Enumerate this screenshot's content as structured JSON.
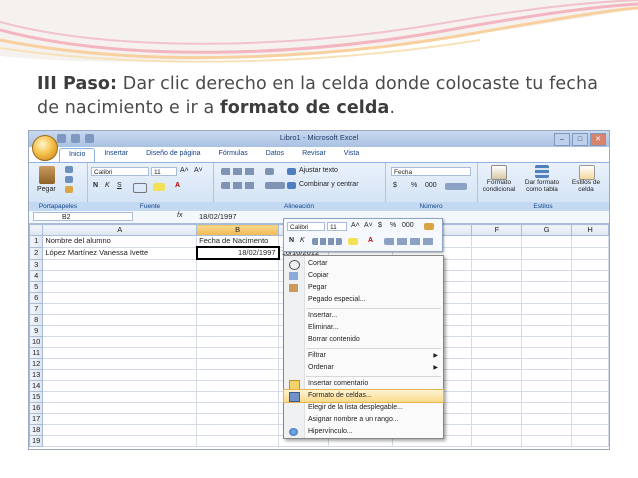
{
  "slide": {
    "step_label": "III Paso:",
    "text_1": " Dar clic derecho en la celda donde colocaste tu fecha de nacimiento e ir a ",
    "bold_phrase": "formato de celda",
    "text_2": "."
  },
  "excel": {
    "window_title": "Libro1 - Microsoft Excel",
    "window_buttons": [
      "–",
      "□",
      "✕"
    ],
    "tabs": [
      "Inicio",
      "Insertar",
      "Diseño de página",
      "Fórmulas",
      "Datos",
      "Revisar",
      "Vista"
    ],
    "active_tab": "Inicio",
    "ribbon": {
      "paste_label": "Pegar",
      "clipboard_group": "Portapapeles",
      "font_name": "Calibri",
      "font_size": "11",
      "grow_font": "A˄",
      "shrink_font": "A˅",
      "bold": "N",
      "italic": "K",
      "underline": "S",
      "font_color": "A",
      "font_group": "Fuente",
      "wrap_text": "Ajustar texto",
      "merge_center": "Combinar y centrar",
      "alignment_group": "Alineación",
      "number_format": "Fecha",
      "currency": "$",
      "percent": "%",
      "thousands": "000",
      "number_group": "Número",
      "conditional_format": "Formato condicional",
      "format_table": "Dar formato como tabla",
      "cell_styles": "Estilos de celda",
      "styles_group": "Estilos"
    },
    "name_box": "B2",
    "fx": "fx",
    "formula_value": "18/02/1997",
    "columns": [
      "A",
      "B",
      "C",
      "D",
      "E",
      "F",
      "G",
      "H"
    ],
    "rows": [
      "1",
      "2",
      "3",
      "4",
      "5",
      "6",
      "7",
      "8",
      "9",
      "10",
      "11",
      "12",
      "13",
      "14",
      "15",
      "16",
      "17",
      "18",
      "19"
    ],
    "cells": {
      "a1": "Nombre del alumno",
      "b1": "Fecha de Nacimento",
      "a2": "López Martínez Vanessa Ivette",
      "b2": "18/02/1997",
      "c2": "10/10/2012"
    },
    "mini_toolbar": {
      "font": "Calibri",
      "size": "11",
      "grow": "A˄",
      "shrink": "A˅",
      "currency": "$",
      "percent": "%",
      "thousands": "000",
      "bold": "N",
      "italic": "K",
      "font_color": "A"
    },
    "context_menu": [
      {
        "label": "Cortar",
        "icon": "scissors-icon"
      },
      {
        "label": "Copiar",
        "icon": "copy-icon"
      },
      {
        "label": "Pegar",
        "icon": "paste-icon"
      },
      {
        "label": "Pegado especial...",
        "icon": ""
      },
      {
        "label": "Insertar...",
        "icon": ""
      },
      {
        "label": "Eliminar...",
        "icon": ""
      },
      {
        "label": "Borrar contenido",
        "icon": ""
      },
      {
        "label": "Filtrar",
        "icon": "",
        "submenu": true
      },
      {
        "label": "Ordenar",
        "icon": "",
        "submenu": true
      },
      {
        "label": "Insertar comentario",
        "icon": "comment-icon"
      },
      {
        "label": "Formato de celdas...",
        "icon": "format-cells-icon",
        "highlighted": true
      },
      {
        "label": "Elegir de la lista desplegable...",
        "icon": ""
      },
      {
        "label": "Asignar nombre a un rango...",
        "icon": ""
      },
      {
        "label": "Hipervínculo...",
        "icon": "hyperlink-icon"
      }
    ],
    "submenu_arrow": "▶"
  },
  "colors": {
    "accent_blue": "#15428b",
    "highlight": "#f9da8a",
    "slide_text": "#4a4a4a"
  }
}
